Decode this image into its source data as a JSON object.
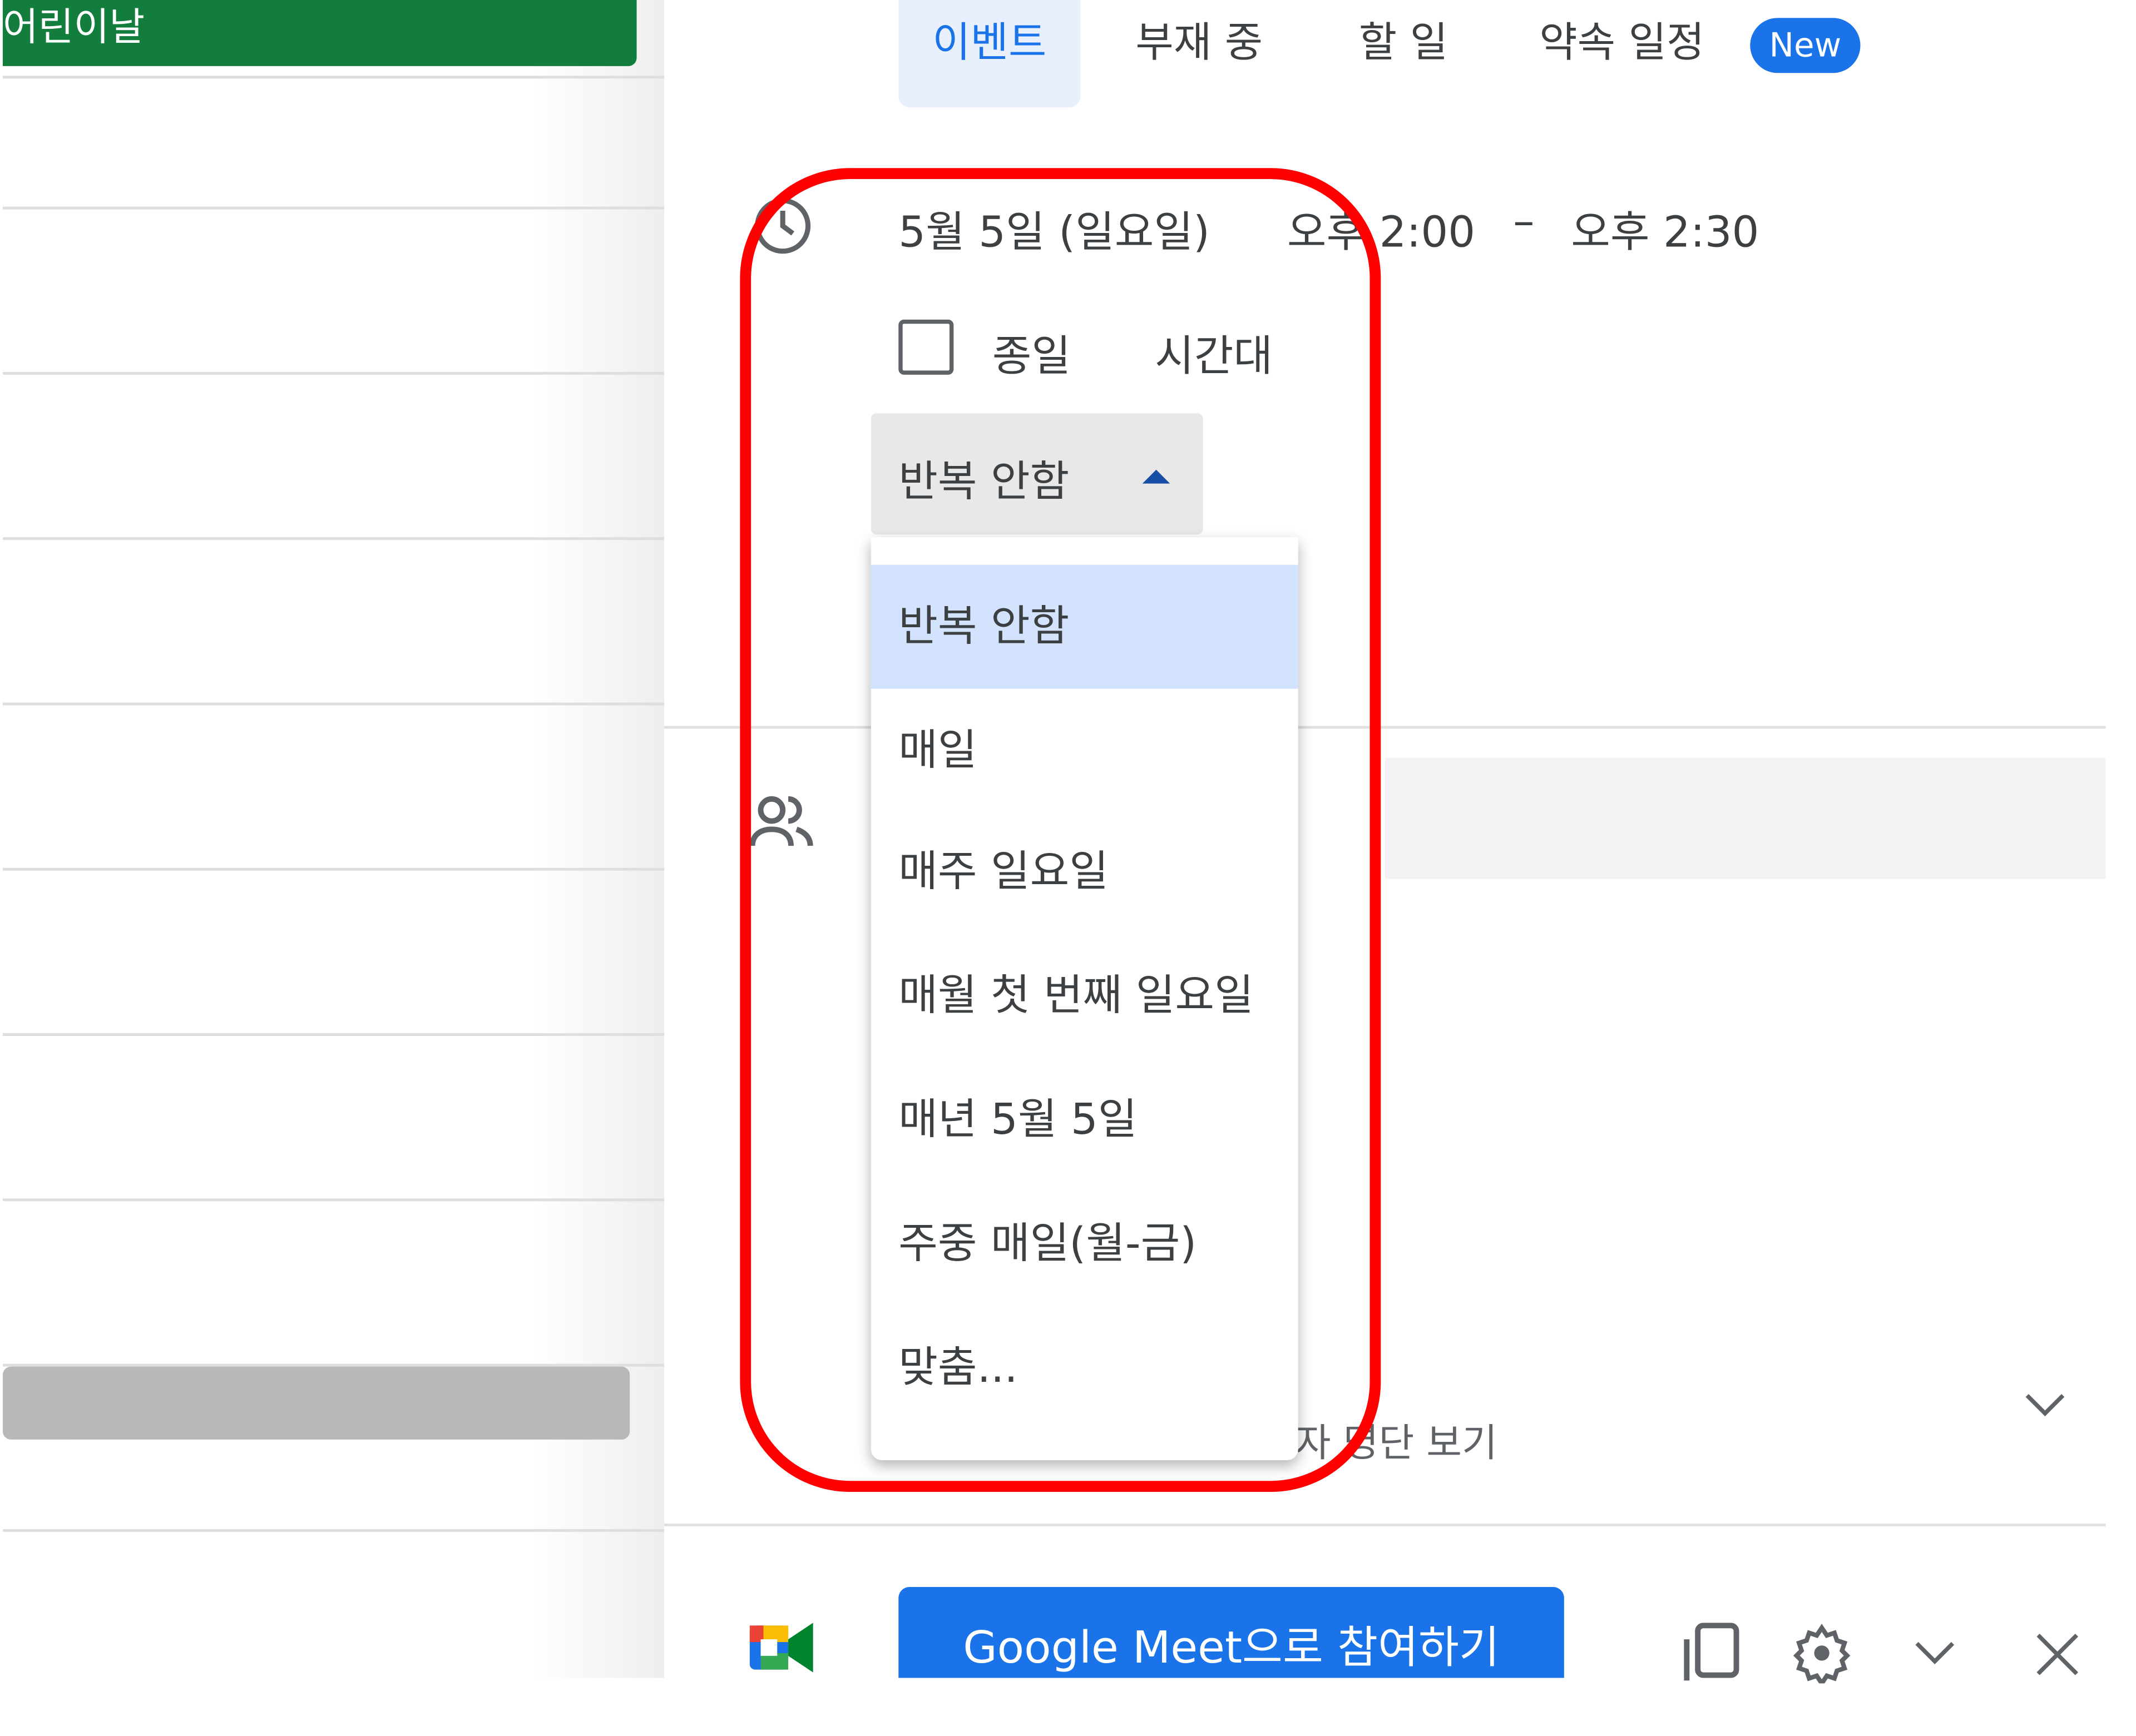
{
  "calendar": {
    "event_chip": "어린이날",
    "event_color": "#137d3e"
  },
  "tabs": [
    {
      "label": "이벤트",
      "active": true
    },
    {
      "label": "부재 중"
    },
    {
      "label": "할 일"
    },
    {
      "label": "약속 일정",
      "badge": "New"
    }
  ],
  "datetime": {
    "date": "5월 5일 (일요일)",
    "start": "오후 2:00",
    "separator": "–",
    "end": "오후 2:30"
  },
  "all_day": {
    "label": "종일",
    "checked": false
  },
  "timezone_label": "시간대",
  "recurrence": {
    "selected": "반복 안함",
    "options": [
      "반복 안함",
      "매일",
      "매주 일요일",
      "매월 첫 번째 일요일",
      "매년 5월 5일",
      "주중 매일(월-금)",
      "맞춤..."
    ]
  },
  "guests": {
    "view_list_partial": "자 명단 보기"
  },
  "footer": {
    "meet_button": "Google Meet으로 참여하기"
  },
  "colors": {
    "accent": "#1a73e8",
    "highlight": "#ff0000",
    "selected_option": "#d3e3fd"
  }
}
